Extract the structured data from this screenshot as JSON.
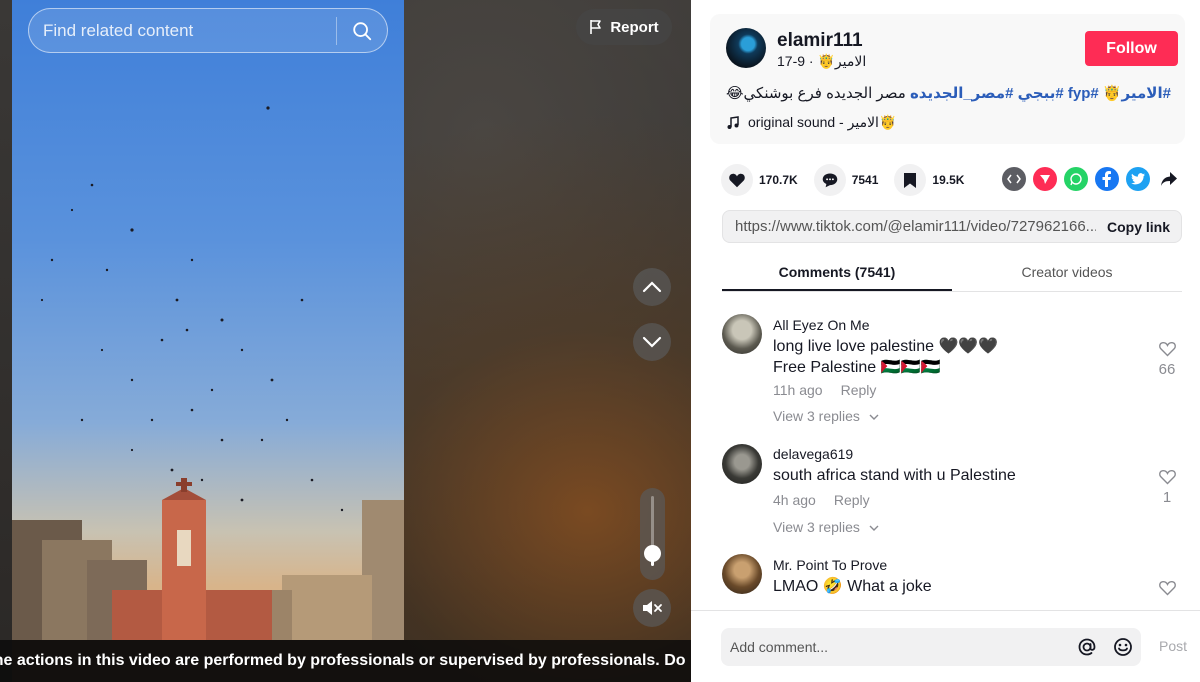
{
  "search": {
    "placeholder": "Find related content"
  },
  "report": {
    "label": "Report"
  },
  "video": {
    "warning": "The actions in this video are performed by professionals or supervised by professionals. Do not attempt.",
    "volume_level": 0.18
  },
  "post": {
    "username": "elamir111",
    "display_name": "الامير🤴",
    "date": "9-17",
    "follow_label": "Follow",
    "caption_text": "مصر الجديده فرع بوشنكي😂",
    "hashtags": [
      "#الامير🤴",
      "#fyp",
      "#ببجي",
      "#مصر_الجديده"
    ],
    "sound": "original sound - الامير🤴"
  },
  "stats": {
    "likes": "170.7K",
    "comments": "7541",
    "saves": "19.5K"
  },
  "share": {
    "icons": [
      "embed-icon",
      "send-icon",
      "whatsapp-icon",
      "facebook-icon",
      "twitter-icon",
      "share-arrow-icon"
    ],
    "colors": {
      "embed": "#5c5d63",
      "send": "#fe2c55",
      "whatsapp": "#25d366",
      "facebook": "#1877f2",
      "twitter": "#1da1f2"
    }
  },
  "link": {
    "url": "https://www.tiktok.com/@elamir111/video/727962166...",
    "copy_label": "Copy link"
  },
  "tabs": [
    {
      "label": "Comments (7541)"
    },
    {
      "label": "Creator videos"
    }
  ],
  "comments": [
    {
      "user": "All Eyez On Me",
      "lines": [
        "long live love palestine 🖤🖤🖤",
        "Free Palestine 🇵🇸🇵🇸🇵🇸"
      ],
      "time": "11h ago",
      "reply": "Reply",
      "view_replies": "View 3 replies",
      "likes": "66"
    },
    {
      "user": "delavega619",
      "lines": [
        "south africa stand with u Palestine"
      ],
      "time": "4h ago",
      "reply": "Reply",
      "view_replies": "View 3 replies",
      "likes": "1"
    },
    {
      "user": "Mr. Point To Prove",
      "lines": [
        "LMAO 🤣 What a joke"
      ],
      "time": "",
      "reply": "",
      "view_replies": "",
      "likes": ""
    }
  ],
  "comment_box": {
    "placeholder": "Add comment...",
    "post_label": "Post"
  },
  "theme": {
    "accent": "#fe2c55",
    "hashtag": "#2b5db9"
  }
}
